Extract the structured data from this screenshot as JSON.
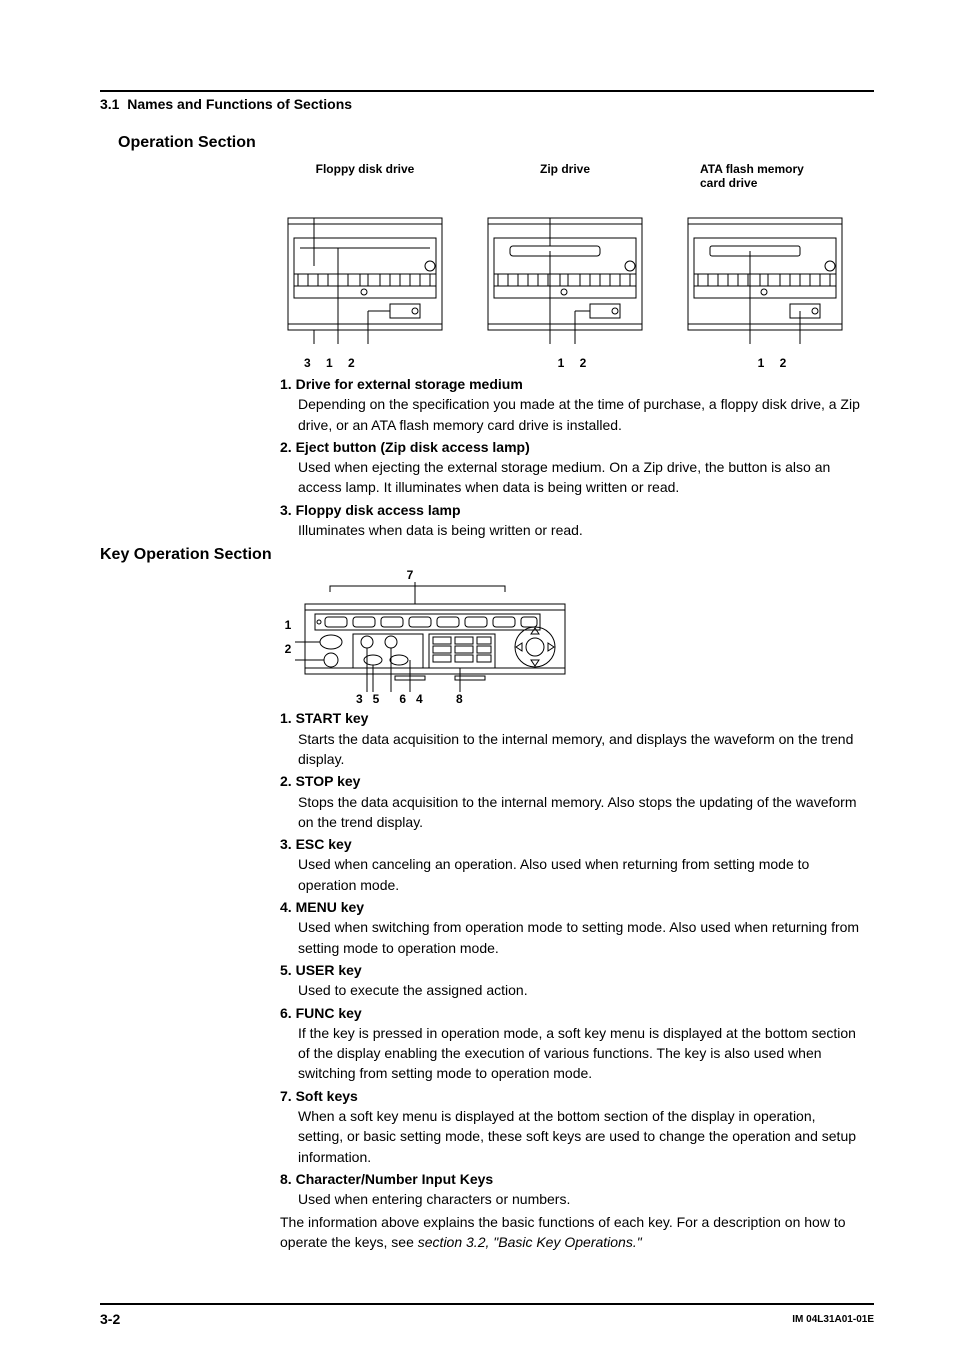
{
  "header": {
    "section_number": "3.1",
    "section_title": "Names and Functions of Sections"
  },
  "operation_section": {
    "title": "Operation Section",
    "diagrams": [
      {
        "label": "Floppy disk drive",
        "callouts": "3   1    2"
      },
      {
        "label": "Zip drive",
        "callouts": "1    2"
      },
      {
        "label": "ATA flash memory\ncard drive",
        "callouts": "1       2"
      }
    ],
    "items": [
      {
        "num": "1.",
        "head": "Drive for external storage medium",
        "body": "Depending on the specification you made at the time of purchase, a floppy disk drive, a Zip drive, or an ATA flash memory card drive is installed."
      },
      {
        "num": "2.",
        "head": "Eject button (Zip disk access lamp)",
        "body": "Used when ejecting the external storage medium.  On a Zip drive, the button is also an access lamp.  It illuminates when data is being written or read."
      },
      {
        "num": "3.",
        "head": "Floppy disk access lamp",
        "body": "Illuminates when data is being written or read."
      }
    ]
  },
  "key_operation_section": {
    "title": "Key Operation Section",
    "top_callout": "7",
    "left_callouts": {
      "one": "1",
      "two": "2"
    },
    "bottom_callouts": "3   5      6   4          8",
    "items": [
      {
        "num": "1.",
        "head": "START key",
        "body": "Starts the data acquisition to the internal memory, and displays the waveform on the trend display."
      },
      {
        "num": "2.",
        "head": "STOP key",
        "body": "Stops the data acquisition to the internal memory.  Also stops the updating of the waveform on the trend display."
      },
      {
        "num": "3.",
        "head": "ESC key",
        "body": "Used when canceling an operation.  Also used when returning from setting mode to operation mode."
      },
      {
        "num": "4.",
        "head": "MENU key",
        "body": "Used when switching from operation mode to setting mode.  Also used when returning from setting mode to operation mode."
      },
      {
        "num": "5.",
        "head": "USER key",
        "body": "Used to execute the assigned action."
      },
      {
        "num": "6.",
        "head": "FUNC key",
        "body": "If the key is pressed in operation mode, a soft key menu is displayed at the bottom section of the display enabling the execution of various functions. The key is also used when switching from setting mode to operation mode."
      },
      {
        "num": "7.",
        "head": "Soft keys",
        "body": "When a soft key menu is displayed at the bottom section of the display in operation, setting, or basic setting mode, these soft keys are used to change the operation and setup information."
      },
      {
        "num": "8.",
        "head": "Character/Number Input Keys",
        "body": "Used when entering characters or numbers."
      }
    ],
    "closing_prefix": "The information above explains the basic functions of each key.  For a description on how to operate the keys, see ",
    "closing_italic": "section 3.2, \"Basic Key Operations.\""
  },
  "footer": {
    "page": "3-2",
    "doc_id": "IM 04L31A01-01E"
  }
}
